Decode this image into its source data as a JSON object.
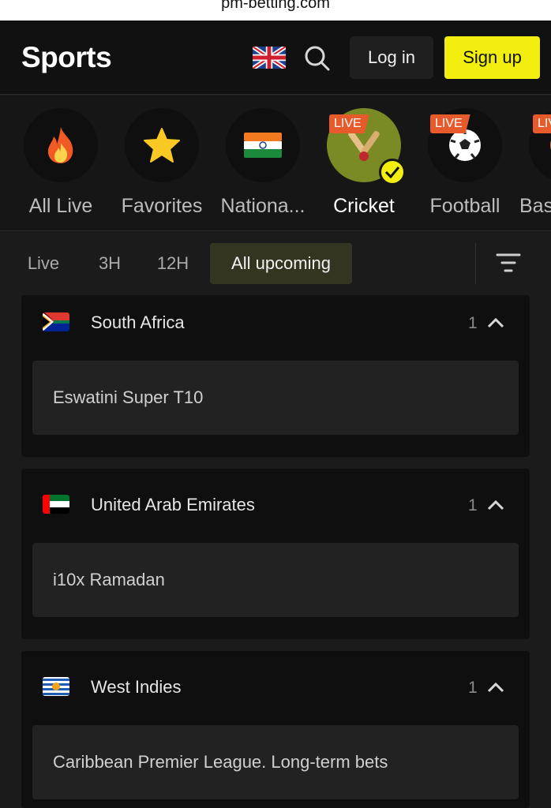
{
  "browser": {
    "url": "pm-betting.com"
  },
  "header": {
    "logo": "Sports",
    "login_label": "Log in",
    "signup_label": "Sign up",
    "accent_color": "#f2ee0e"
  },
  "sports": [
    {
      "label": "All Live",
      "icon": "fire-icon",
      "live": false
    },
    {
      "label": "Favorites",
      "icon": "star-icon",
      "live": false
    },
    {
      "label": "Nationa...",
      "icon": "india-flag-icon",
      "live": false
    },
    {
      "label": "Cricket",
      "icon": "cricket-icon",
      "live": true,
      "active": true
    },
    {
      "label": "Football",
      "icon": "football-icon",
      "live": true
    },
    {
      "label": "Bas",
      "icon": "basketball-icon",
      "live": true
    }
  ],
  "live_badge": "LIVE",
  "filters": [
    {
      "label": "Live"
    },
    {
      "label": "3H"
    },
    {
      "label": "12H"
    },
    {
      "label": "All upcoming",
      "active": true
    }
  ],
  "groups": [
    {
      "name": "South Africa",
      "count": "1",
      "flag": "south-africa-flag-icon",
      "tournaments": [
        "Eswatini Super T10"
      ]
    },
    {
      "name": "United Arab Emirates",
      "count": "1",
      "flag": "uae-flag-icon",
      "tournaments": [
        "i10x Ramadan"
      ]
    },
    {
      "name": "West Indies",
      "count": "1",
      "flag": "west-indies-flag-icon",
      "tournaments": [
        "Caribbean Premier League. Long-term bets"
      ]
    }
  ]
}
